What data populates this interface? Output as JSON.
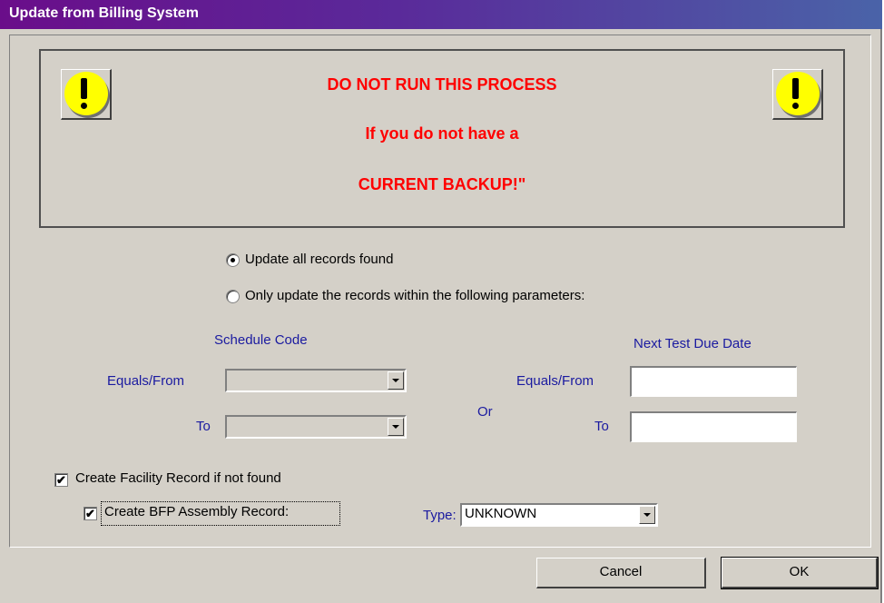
{
  "window": {
    "title": "Update from Billing System"
  },
  "warning": {
    "line1": "DO NOT RUN THIS PROCESS",
    "line2": "If you do not have a",
    "line3": "CURRENT BACKUP!\"",
    "icon_left": "exclamation-icon",
    "icon_right": "exclamation-icon",
    "color": "#ff0000"
  },
  "options": {
    "update_all": "Update all records found",
    "update_params": "Only update the records within the following parameters:",
    "selected": "update_all"
  },
  "schedule": {
    "heading": "Schedule Code",
    "from_label": "Equals/From",
    "to_label": "To",
    "from_value": "",
    "to_value": ""
  },
  "or_label": "Or",
  "due_date": {
    "heading": "Next Test Due Date",
    "from_label": "Equals/From",
    "to_label": "To",
    "from_value": "",
    "to_value": ""
  },
  "checks": {
    "create_facility": "Create Facility Record if not found",
    "create_facility_checked": true,
    "create_bfp": "Create BFP Assembly Record:",
    "create_bfp_checked": true
  },
  "type": {
    "label": "Type:",
    "value": "UNKNOWN"
  },
  "buttons": {
    "cancel": "Cancel",
    "ok": "OK"
  },
  "colors": {
    "label_blue": "#1a1aa0",
    "titlebar_start": "#6a0d8a",
    "titlebar_end": "#4a63a8"
  }
}
